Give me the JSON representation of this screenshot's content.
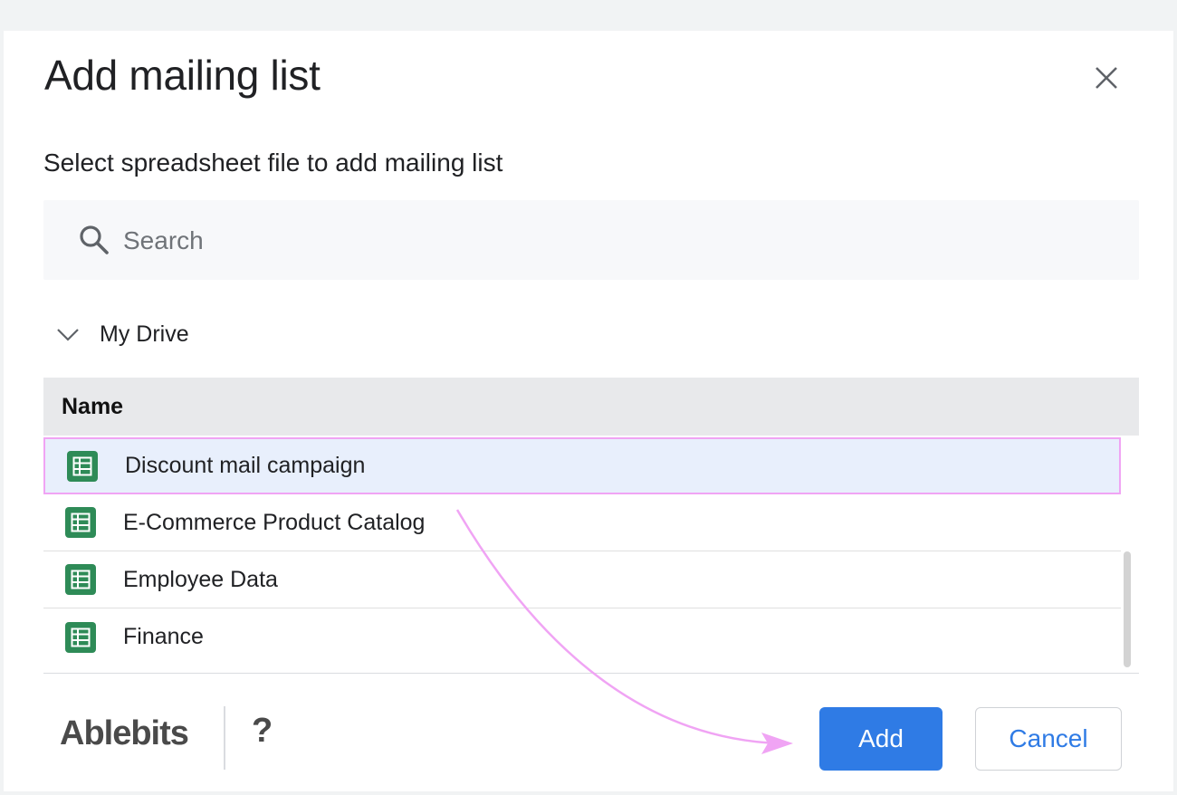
{
  "dialog": {
    "title": "Add mailing list",
    "close_icon": "close-icon",
    "subtitle": "Select spreadsheet file to add mailing list"
  },
  "search": {
    "placeholder": "Search",
    "value": "",
    "icon": "search-icon"
  },
  "folder": {
    "label": "My Drive",
    "icon": "chevron-down-icon"
  },
  "table": {
    "header": "Name",
    "rows": [
      {
        "label": "Discount mail campaign",
        "icon": "spreadsheet-icon",
        "selected": true
      },
      {
        "label": "E-Commerce Product Catalog",
        "icon": "spreadsheet-icon",
        "selected": false
      },
      {
        "label": "Employee Data",
        "icon": "spreadsheet-icon",
        "selected": false
      },
      {
        "label": "Finance",
        "icon": "spreadsheet-icon",
        "selected": false
      }
    ]
  },
  "footer": {
    "logo": "Ablebits",
    "help": "?",
    "add_label": "Add",
    "cancel_label": "Cancel"
  },
  "colors": {
    "primary": "#2f7be5",
    "selected_row": "#e8effc",
    "highlight": "#f0a4f4",
    "sheet_green": "#2e8b57"
  }
}
